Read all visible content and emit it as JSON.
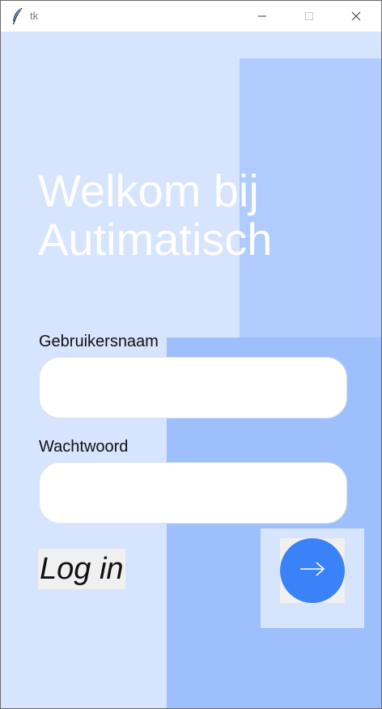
{
  "window": {
    "title": "tk",
    "app_icon": "feather-icon",
    "controls": [
      "minimize-icon",
      "maximize-icon",
      "close-icon"
    ]
  },
  "login": {
    "welcome_line1": "Welkom bij",
    "welcome_line2": "Autimatisch",
    "username_label": "Gebruikersnaam",
    "username_value": "",
    "password_label": "Wachtwoord",
    "password_value": "",
    "login_label": "Log in",
    "submit_icon": "arrow-right-icon"
  },
  "colors": {
    "background": "#d6e4fd",
    "accent_light": "#b0cbfd",
    "accent_mid": "#9dbffb",
    "button": "#3a82f7",
    "heading": "#ffffff"
  }
}
